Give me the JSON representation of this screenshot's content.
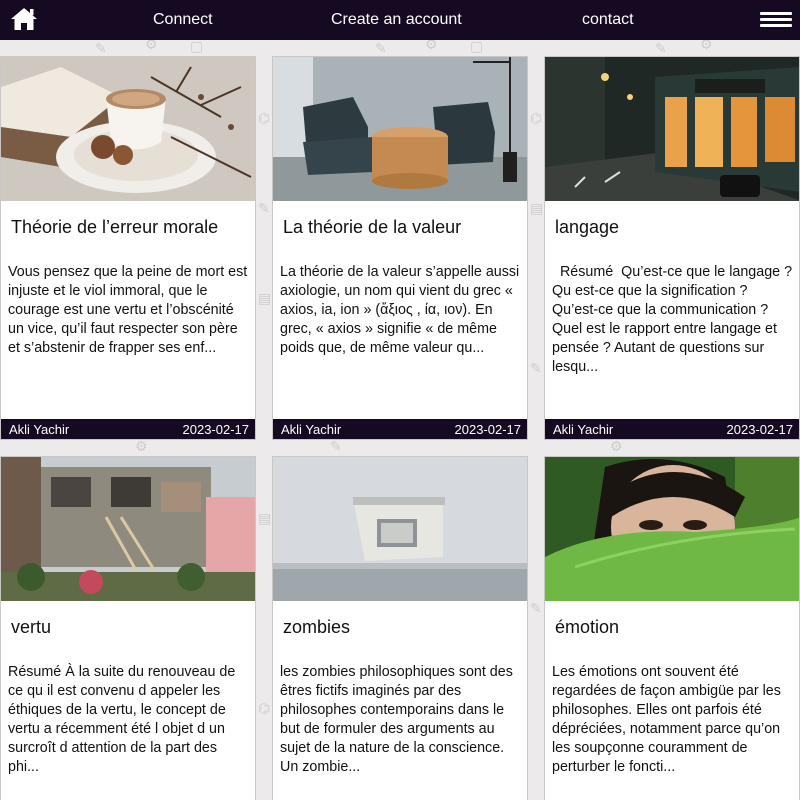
{
  "nav": {
    "home_icon": "home-icon",
    "connect": "Connect",
    "create_account": "Create an account",
    "contact": "contact",
    "menu_icon": "hamburger-menu-icon"
  },
  "colors": {
    "nav_bg": "#150a22",
    "page_bg": "#eceaea",
    "card_bg": "#ffffff"
  },
  "cards": [
    {
      "title": "Théorie de l’erreur morale",
      "excerpt": "Vous pensez que la peine de mort est injuste et le viol immoral, que le courage est une vertu et l’obscénité un vice, qu’il faut respecter son père et s’abstenir de frapper ses enf...",
      "author": "Akli Yachir",
      "date": "2023-02-17"
    },
    {
      "title": "La théorie de la valeur",
      "excerpt": "La théorie de la valeur s’appelle aussi axiologie, un nom qui vient du grec « axios, ia, ion » (ἄξιος , ία, ιον). En grec, « axios » signifie « de même poids que, de même valeur qu...",
      "author": "Akli Yachir",
      "date": "2023-02-17"
    },
    {
      "title": "langage",
      "excerpt": "  Résumé  Qu’est-ce que le langage ? Qu est-ce que la signification ? Qu’est-ce que la communication ? Quel est le rapport entre langage et pensée ? Autant de questions sur lesqu...",
      "author": "Akli Yachir",
      "date": "2023-02-17"
    },
    {
      "title": "vertu",
      "excerpt": "Résumé À la suite du renouveau de ce qu il est convenu d appeler les éthiques de la vertu, le concept de vertu a récemment été l objet d un surcroît d attention de la part des phi...",
      "author": "",
      "date": ""
    },
    {
      "title": "zombies",
      "excerpt": "les zombies philosophiques sont des êtres fictifs imaginés par des philosophes contemporains dans le but de formuler des arguments au sujet de la nature de la conscience. Un zombie...",
      "author": "",
      "date": ""
    },
    {
      "title": "émotion",
      "excerpt": "Les émotions ont souvent été regardées de façon ambigüe par les philosophes. Elles ont parfois été dépréciées, notamment parce qu’on les soupçonne couramment de perturber le foncti...",
      "author": "",
      "date": ""
    }
  ]
}
